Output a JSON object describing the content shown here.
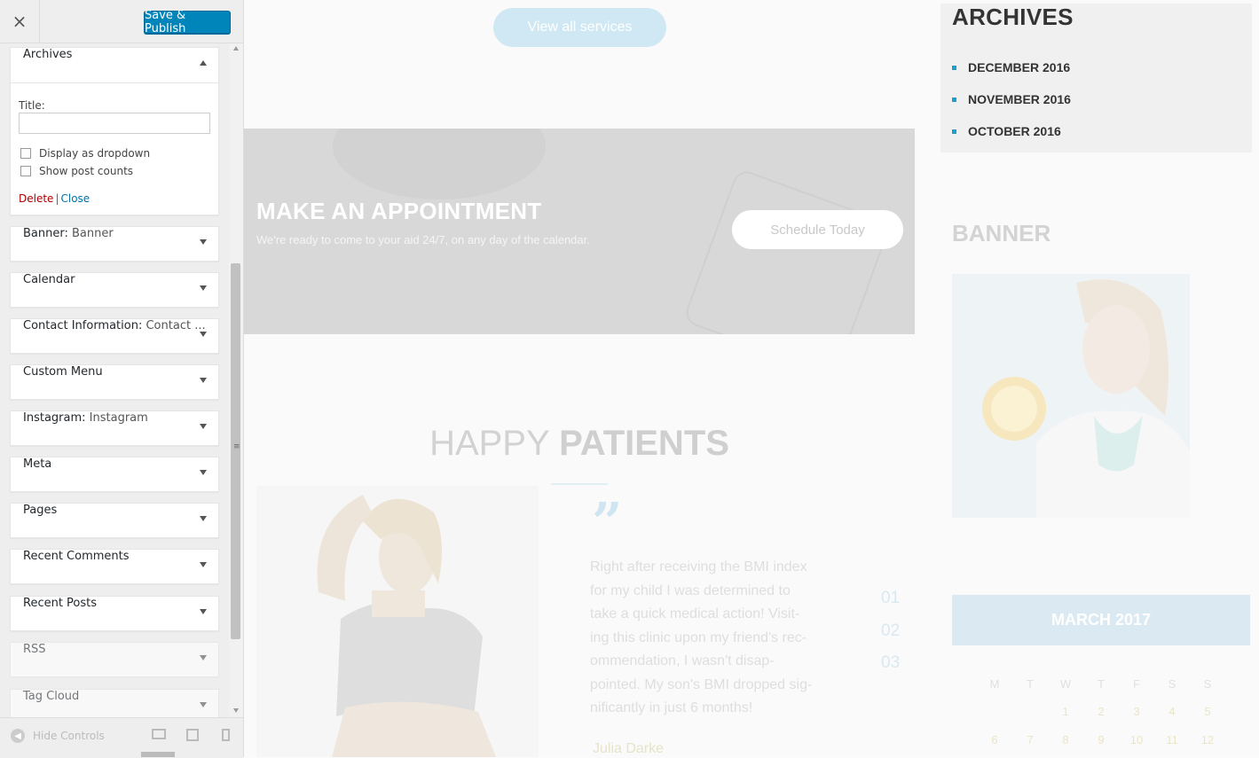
{
  "header": {
    "save_label": "Save & Publish",
    "close_glyph": "×"
  },
  "archives_widget": {
    "title": "Archives",
    "title_label": "Title:",
    "title_value": "",
    "option1": "Display as dropdown",
    "option2": "Show post counts",
    "delete_label": "Delete",
    "separator": "|",
    "close_label": "Close"
  },
  "widgets": [
    {
      "name": "Banner:",
      "sub": "Banner"
    },
    {
      "name": "Calendar",
      "sub": ""
    },
    {
      "name": "Contact Information:",
      "sub": "Contact ..."
    },
    {
      "name": "Custom Menu",
      "sub": ""
    },
    {
      "name": "Instagram:",
      "sub": "Instagram"
    },
    {
      "name": "Meta",
      "sub": ""
    },
    {
      "name": "Pages",
      "sub": ""
    },
    {
      "name": "Recent Comments",
      "sub": ""
    },
    {
      "name": "Recent Posts",
      "sub": ""
    },
    {
      "name": "RSS",
      "sub": ""
    },
    {
      "name": "Tag Cloud",
      "sub": ""
    }
  ],
  "footer": {
    "hide_label": "Hide Controls"
  },
  "preview": {
    "view_all": "View all services",
    "appointment_title": "MAKE AN APPOINTMENT",
    "appointment_sub": "We're ready to come to your aid 24/7, on any day of the calendar.",
    "schedule_btn": "Schedule Today",
    "happy": "HAPPY",
    "patients": "PATIENTS",
    "quote_glyph": "”",
    "testimonial_lines": [
      "Right after receiving the BMI index",
      "for my child I was determined to",
      "take a quick medical action! Visit-",
      "ing this clinic upon my friend's rec-",
      "ommendation, I wasn't disap-",
      "pointed. My son's BMI dropped sig-",
      "nificantly in just 6 months!"
    ],
    "author": "Julia Darke",
    "pager": [
      "01",
      "02",
      "03"
    ],
    "archives_title": "ARCHIVES",
    "archive_items": [
      "DECEMBER 2016",
      "NOVEMBER 2016",
      "OCTOBER 2016"
    ],
    "banner_title": "BANNER",
    "calendar_title": "MARCH 2017",
    "weekdays": [
      "M",
      "T",
      "W",
      "T",
      "F",
      "S",
      "S"
    ],
    "week1": [
      "",
      "",
      "1",
      "2",
      "3",
      "4",
      "5"
    ],
    "week2": [
      "6",
      "7",
      "8",
      "9",
      "10",
      "11",
      "12"
    ]
  },
  "colors": {
    "accent": "#0085ba",
    "link": "#0073aa",
    "delete": "#aa0000",
    "bullet": "#1a9fd0"
  }
}
